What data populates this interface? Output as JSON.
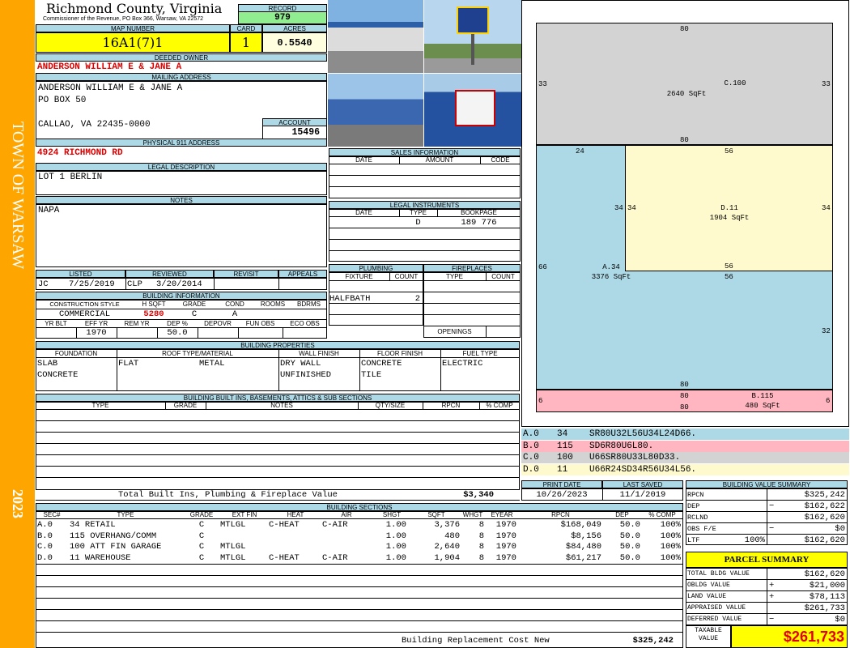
{
  "sidebar": {
    "town": "TOWN OF WARSAW",
    "year": "2023"
  },
  "header": {
    "county": "Richmond County, Virginia",
    "commissioner": "Commissioner of the Revenue, PO Box 366, Warsaw, VA 22572",
    "record_label": "RECORD",
    "record": "979"
  },
  "parcel": {
    "map_label": "MAP NUMBER",
    "map_number": "16A1(7)1",
    "card_label": "CARD",
    "card": "1",
    "acres_label": "ACRES",
    "acres": "0.5540",
    "owner_label": "DEEDED OWNER",
    "owner": "ANDERSON WILLIAM E & JANE A",
    "mailing_label": "MAILING ADDRESS",
    "mail_line1": "ANDERSON WILLIAM E & JANE A",
    "mail_line2": "PO BOX 50",
    "mail_line3": "CALLAO, VA 22435-0000",
    "account_label": "ACCOUNT",
    "account": "15496",
    "physical_label": "PHYSICAL 911 ADDRESS",
    "physical": "4924 RICHMOND RD",
    "legal_label": "LEGAL DESCRIPTION",
    "legal": "LOT 1 BERLIN",
    "notes_label": "NOTES",
    "notes": "NAPA"
  },
  "review": {
    "listed_label": "LISTED",
    "listed_by": "JC",
    "listed_date": "7/25/2019",
    "reviewed_label": "REVIEWED",
    "reviewed_by": "CLP",
    "reviewed_date": "3/20/2014",
    "revisit_label": "REVISIT",
    "appeals_label": "APPEALS"
  },
  "building_info": {
    "title": "BUILDING INFORMATION",
    "h_style": "CONSTRUCTION STYLE",
    "h_sqft": "H SQFT",
    "h_grade": "GRADE",
    "h_cond": "COND",
    "h_rooms": "ROOMS",
    "h_bdrms": "BDRMS",
    "style": "COMMERCIAL",
    "sqft": "5280",
    "grade": "C",
    "cond": "A",
    "h_yrblt": "YR BLT",
    "h_effyr": "EFF YR",
    "h_remyr": "REM YR",
    "h_dep": "DEP %",
    "h_depovr": "DEPOVR",
    "h_funobs": "FUN OBS",
    "h_ecoobs": "ECO OBS",
    "effyr": "1970",
    "dep": "50.0"
  },
  "sales": {
    "title": "SALES INFORMATION",
    "h_date": "DATE",
    "h_amount": "AMOUNT",
    "h_code": "CODE"
  },
  "legal_instr": {
    "title": "LEGAL INSTRUMENTS",
    "h_date": "DATE",
    "h_type": "TYPE",
    "h_book": "BOOKPAGE",
    "type": "D",
    "book": "189 776"
  },
  "plumbing": {
    "title": "PLUMBING",
    "h_fixture": "FIXTURE",
    "h_count": "COUNT",
    "fixture": "HALFBATH",
    "count": "2"
  },
  "fireplaces": {
    "title": "FIREPLACES",
    "h_type": "TYPE",
    "h_count": "COUNT",
    "openings": "OPENINGS"
  },
  "properties": {
    "title": "BUILDING PROPERTIES",
    "h_foundation": "FOUNDATION",
    "h_roof": "ROOF TYPE/MATERIAL",
    "h_wall": "WALL FINISH",
    "h_floor": "FLOOR FINISH",
    "h_fuel": "FUEL TYPE",
    "foundation1": "SLAB",
    "foundation2": "CONCRETE",
    "roof_type": "FLAT",
    "roof_mat": "METAL",
    "wall1": "DRY WALL",
    "wall2": "UNFINISHED",
    "floor1": "CONCRETE",
    "floor2": "TILE",
    "fuel": "ELECTRIC"
  },
  "builtins": {
    "title": "BUILDING BUILT INS, BASEMENTS, ATTICS & SUB SECTIONS",
    "h_type": "TYPE",
    "h_grade": "GRADE",
    "h_notes": "NOTES",
    "h_qty": "QTY/SIZE",
    "h_rpcn": "RPCN",
    "h_comp": "% COMP",
    "total_label": "Total Built Ins, Plumbing & Fireplace Value",
    "total": "$3,340"
  },
  "dates": {
    "print_label": "PRINT DATE",
    "print": "10/26/2023",
    "saved_label": "LAST SAVED",
    "saved": "11/1/2019"
  },
  "sections": {
    "title": "BUILDING SECTIONS",
    "headers": [
      "SEC#",
      "TYPE",
      "GRADE",
      "EXT FIN",
      "HEAT",
      "AIR",
      "SHGT",
      "SQFT",
      "WHGT",
      "EYEAR",
      "RPCN",
      "DEP",
      "% COMP"
    ],
    "rows": [
      {
        "sec": "A.0",
        "type": "34 RETAIL",
        "grade": "C",
        "ext": "MTLGL",
        "heat": "C-HEAT",
        "air": "C-AIR",
        "shgt": "1.00",
        "sqft": "3,376",
        "whgt": "8",
        "eyear": "1970",
        "rpcn": "$168,049",
        "dep": "50.0",
        "comp": "100%"
      },
      {
        "sec": "B.0",
        "type": "115 OVERHANG/COMM",
        "grade": "C",
        "ext": "",
        "heat": "",
        "air": "",
        "shgt": "1.00",
        "sqft": "480",
        "whgt": "8",
        "eyear": "1970",
        "rpcn": "$8,156",
        "dep": "50.0",
        "comp": "100%"
      },
      {
        "sec": "C.0",
        "type": "100 ATT FIN GARAGE",
        "grade": "C",
        "ext": "MTLGL",
        "heat": "",
        "air": "",
        "shgt": "1.00",
        "sqft": "2,640",
        "whgt": "8",
        "eyear": "1970",
        "rpcn": "$84,480",
        "dep": "50.0",
        "comp": "100%"
      },
      {
        "sec": "D.0",
        "type": "11 WAREHOUSE",
        "grade": "C",
        "ext": "MTLGL",
        "heat": "C-HEAT",
        "air": "C-AIR",
        "shgt": "1.00",
        "sqft": "1,904",
        "whgt": "8",
        "eyear": "1970",
        "rpcn": "$61,217",
        "dep": "50.0",
        "comp": "100%"
      }
    ],
    "replacement_label": "Building Replacement Cost New",
    "replacement": "$325,242"
  },
  "value_summary": {
    "title": "BUILDING VALUE SUMMARY",
    "rpcn_label": "RPCN",
    "rpcn": "$325,242",
    "dep_label": "DEP",
    "dep_sign": "−",
    "dep": "$162,622",
    "rclnd_label": "RCLND",
    "rclnd": "$162,620",
    "obs_label": "OBS F/E",
    "obs_sign": "−",
    "obs": "$0",
    "ltr_label": "LTF",
    "ltr_pct": "100%",
    "ltr": "$162,620"
  },
  "parcel_summary": {
    "title": "PARCEL SUMMARY",
    "bldg_label": "TOTAL BLDG VALUE",
    "bldg": "$162,620",
    "obldg_label": "OBLDG VALUE",
    "obldg_sign": "+",
    "obldg": "$21,000",
    "land_label": "LAND VALUE",
    "land_sign": "+",
    "land": "$78,113",
    "appr_label": "APPRAISED VALUE",
    "appr": "$261,733",
    "def_label": "DEFERRED VALUE",
    "def_sign": "−",
    "def": "$0",
    "taxable_label1": "TAXABLE",
    "taxable_label2": "VALUE",
    "taxable": "$261,733"
  },
  "sketch": {
    "sections": [
      {
        "code": "C.100",
        "area": "2640 SqFt",
        "color": "#d3d3d3"
      },
      {
        "code": "D.11",
        "area": "1904 SqFt",
        "color": "#fffacd"
      },
      {
        "code": "A.34",
        "area": "3376 SqFt",
        "color": "#add8e6"
      },
      {
        "code": "B.115",
        "area": "480 SqFt",
        "color": "#ffb6c1"
      }
    ],
    "dims": {
      "c_top": "80",
      "c_left": "33",
      "c_right": "33",
      "c_bottom": "80",
      "a_top_left": "24",
      "d_top": "56",
      "d_left_a": "34",
      "d_left": "34",
      "d_right": "34",
      "d_bottom": "56",
      "a_mid": "56",
      "a_left": "66",
      "a_right": "32",
      "a_bottom": "80",
      "b_top": "80",
      "b_bottom": "80",
      "b_left": "6",
      "b_right": "6"
    }
  },
  "traverse": [
    {
      "sec": "A.0",
      "code": "34",
      "path": "SR80U32L56U34L24D66.",
      "color": "#add8e6"
    },
    {
      "sec": "B.0",
      "code": "115",
      "path": "SD6R80U6L80.",
      "color": "#ffb6c1"
    },
    {
      "sec": "C.0",
      "code": "100",
      "path": "U66SR80U33L80D33.",
      "color": "#d3d3d3"
    },
    {
      "sec": "D.0",
      "code": "11",
      "path": "U66R24SD34R56U34L56.",
      "color": "#fffacd"
    }
  ],
  "photos": [
    {
      "name": "photo-storefront"
    },
    {
      "name": "photo-sign"
    },
    {
      "name": "photo-side-building"
    },
    {
      "name": "photo-auto-parts-sign"
    }
  ]
}
